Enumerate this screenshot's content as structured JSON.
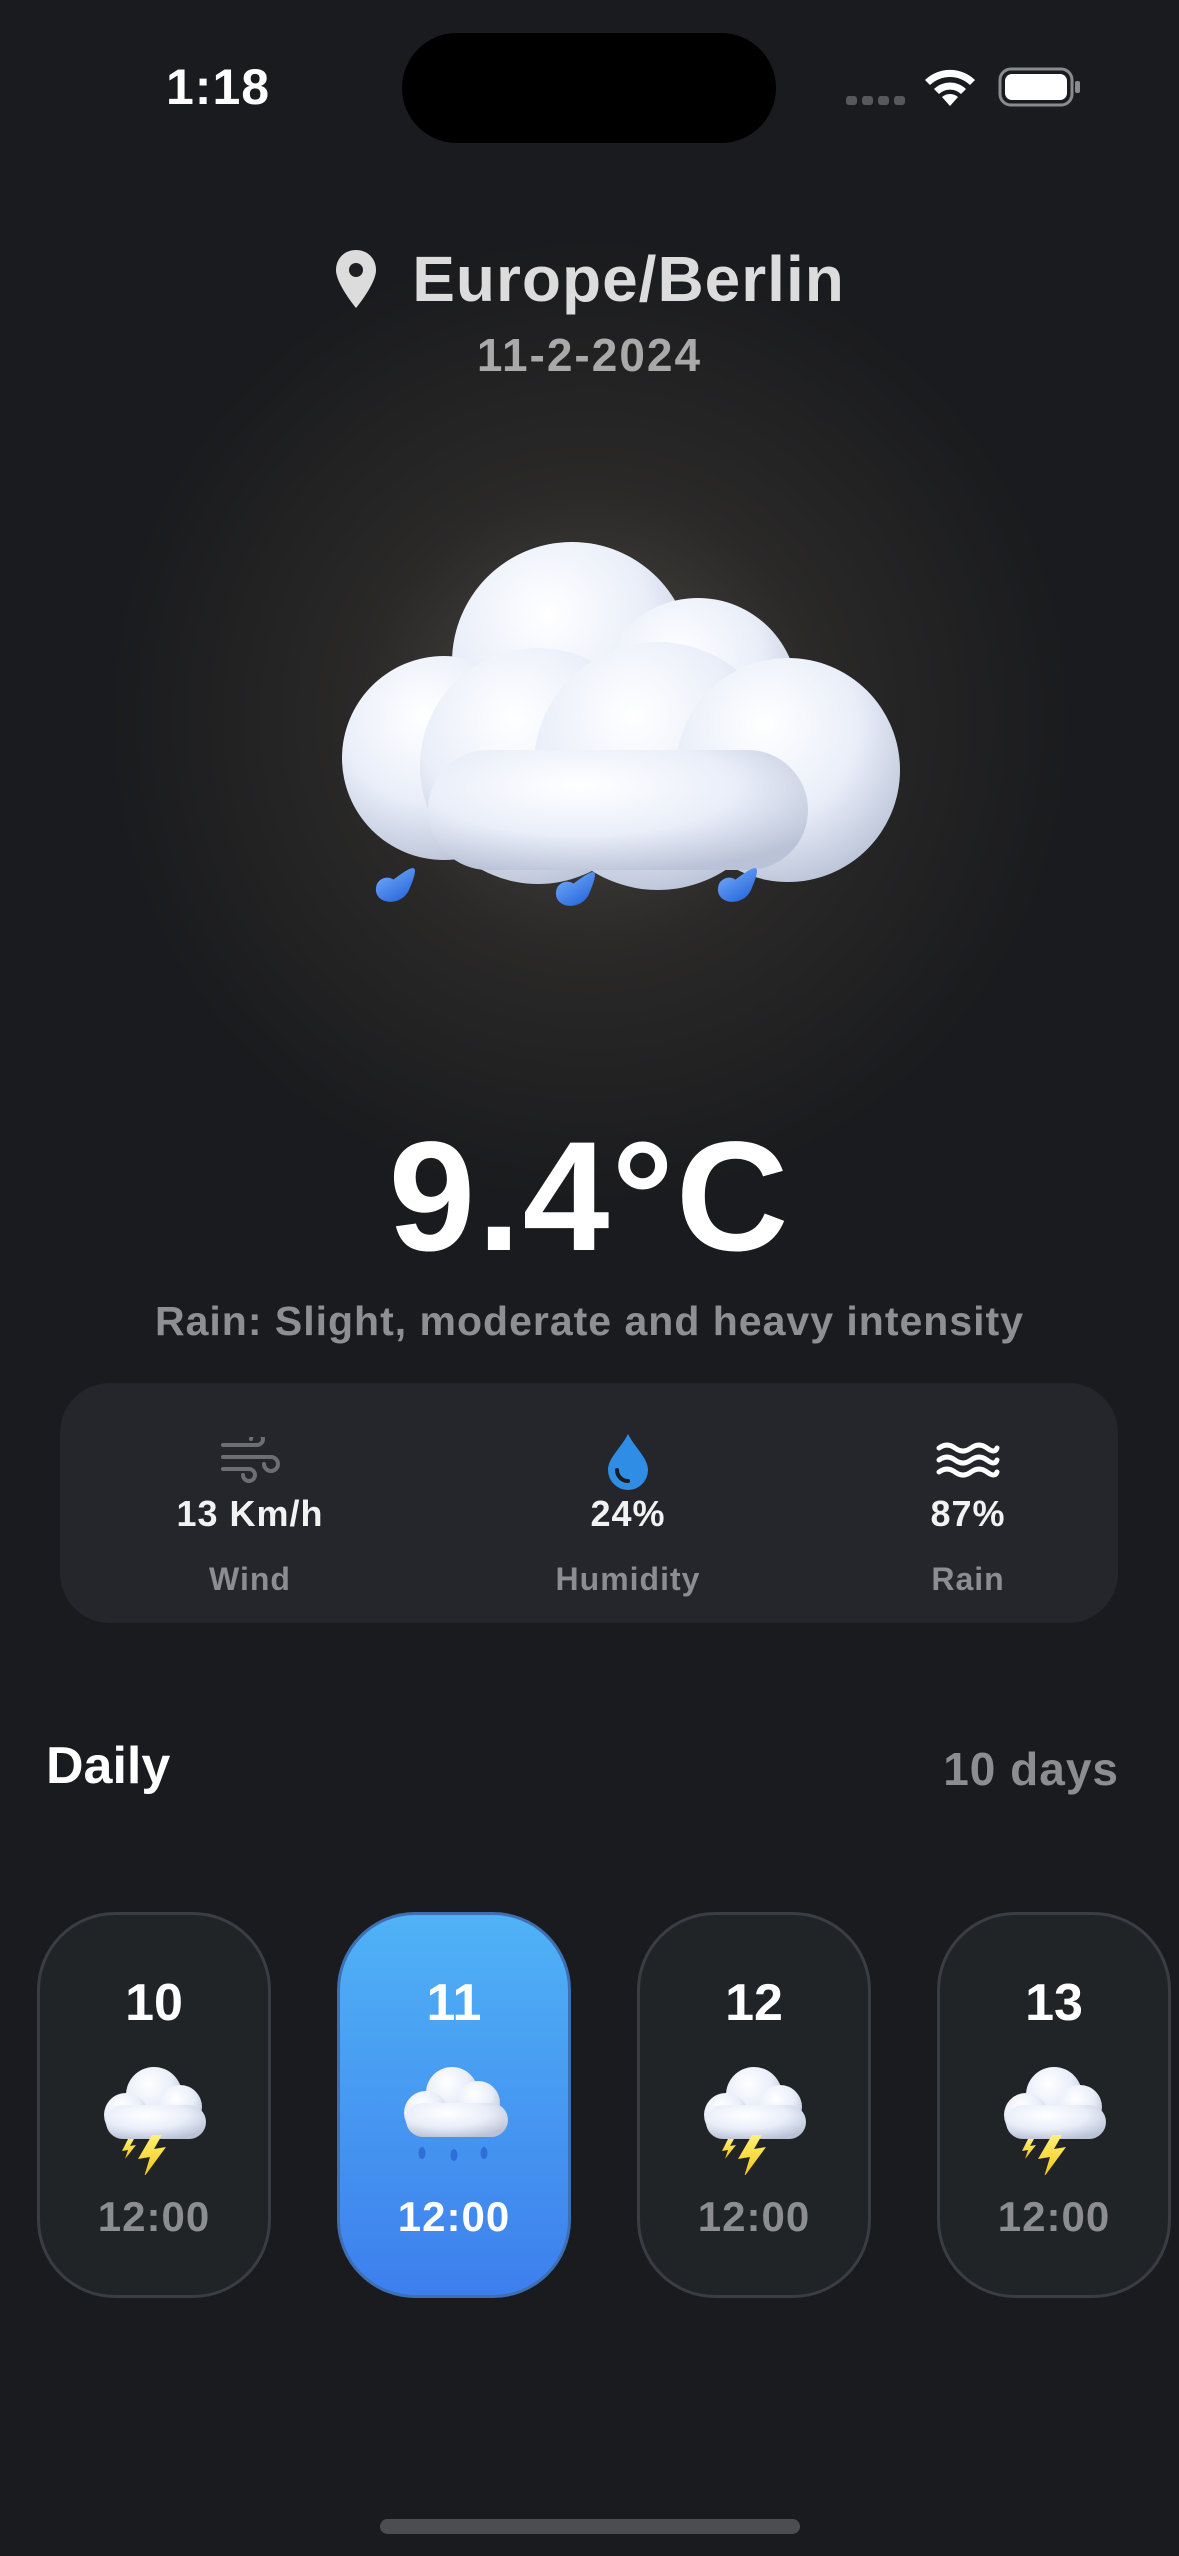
{
  "status_bar": {
    "time": "1:18"
  },
  "location": {
    "city": "Europe/Berlin",
    "date": "11-2-2024"
  },
  "current": {
    "temperature": "9.4°C",
    "condition": "Rain: Slight, moderate and heavy intensity",
    "icon": "rain-cloud-icon"
  },
  "stats": [
    {
      "value": "13 Km/h",
      "label": "Wind",
      "icon": "wind-icon"
    },
    {
      "value": "24%",
      "label": "Humidity",
      "icon": "humidity-drop-icon"
    },
    {
      "value": "87%",
      "label": "Rain",
      "icon": "waves-icon"
    }
  ],
  "daily": {
    "title": "Daily",
    "range": "10 days",
    "days": [
      {
        "day": "10",
        "time": "12:00",
        "icon": "thunderstorm-icon",
        "selected": false
      },
      {
        "day": "11",
        "time": "12:00",
        "icon": "rain-cloud-icon",
        "selected": true
      },
      {
        "day": "12",
        "time": "12:00",
        "icon": "thunderstorm-icon",
        "selected": false
      },
      {
        "day": "13",
        "time": "12:00",
        "icon": "thunderstorm-icon",
        "selected": false
      }
    ]
  },
  "colors": {
    "accent_blue": "#3d7fed",
    "background": "#1a1b1e",
    "card": "#25262b"
  }
}
